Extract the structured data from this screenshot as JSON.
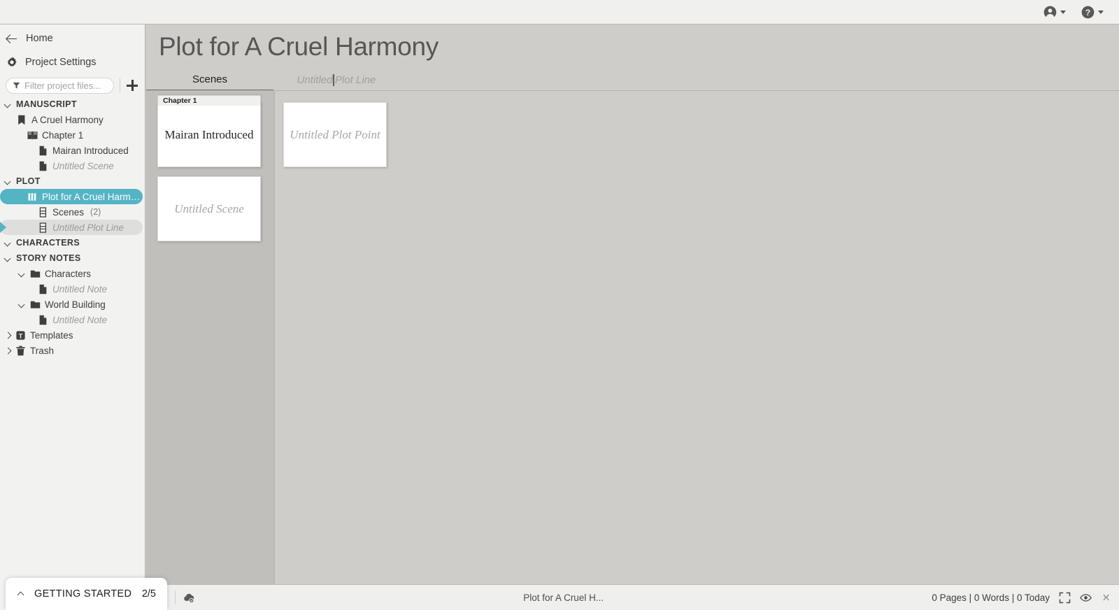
{
  "topbar": {
    "account_icon": "account-circle-icon",
    "account_caret": "chevron-down-icon",
    "help_icon": "help-circle-icon",
    "help_caret": "chevron-down-icon"
  },
  "sidebar": {
    "home_label": "Home",
    "home_icon": "arrow-left-icon",
    "project_settings_label": "Project Settings",
    "project_settings_icon": "gear-icon",
    "filter": {
      "placeholder": "Filter project files...",
      "value": "",
      "icon": "filter-funnel-icon"
    },
    "add_icon": "plus-icon",
    "groups": [
      {
        "name": "MANUSCRIPT",
        "expanded": true,
        "items": [
          {
            "label": "A Cruel Harmony",
            "icon": "book-closed-icon",
            "indent": 1,
            "italic": false,
            "state": "none"
          },
          {
            "label": "Chapter 1",
            "icon": "book-open-icon",
            "indent": 2,
            "italic": false,
            "state": "none"
          },
          {
            "label": "Mairan Introduced",
            "icon": "document-icon",
            "indent": 3,
            "italic": false,
            "state": "none"
          },
          {
            "label": "Untitled Scene",
            "icon": "document-icon",
            "indent": 3,
            "italic": true,
            "state": "none"
          }
        ]
      },
      {
        "name": "PLOT",
        "expanded": true,
        "items": [
          {
            "label": "Plot for A Cruel Harmony",
            "icon": "plot-bars-icon",
            "indent": 2,
            "italic": false,
            "state": "selected"
          },
          {
            "label": "Scenes",
            "count": "(2)",
            "icon": "plotline-icon",
            "indent": 3,
            "italic": false,
            "state": "none"
          },
          {
            "label": "Untitled Plot Line",
            "icon": "plotline-icon",
            "indent": 3,
            "italic": true,
            "state": "active"
          }
        ]
      },
      {
        "name": "CHARACTERS",
        "expanded": true,
        "items": []
      },
      {
        "name": "STORY NOTES",
        "expanded": true,
        "items": [
          {
            "label": "Characters",
            "icon": "folder-icon",
            "indent": 2,
            "italic": false,
            "state": "none",
            "chevron": "down"
          },
          {
            "label": "Untitled Note",
            "icon": "document-icon",
            "indent": 3,
            "italic": true,
            "state": "none"
          },
          {
            "label": "World Building",
            "icon": "folder-icon",
            "indent": 2,
            "italic": false,
            "state": "none",
            "chevron": "down"
          },
          {
            "label": "Untitled Note",
            "icon": "document-icon",
            "indent": 3,
            "italic": true,
            "state": "none"
          }
        ]
      }
    ],
    "footer_items": [
      {
        "label": "Templates",
        "icon": "templates-t-icon",
        "chevron": "right"
      },
      {
        "label": "Trash",
        "icon": "trash-icon",
        "chevron": "right"
      }
    ]
  },
  "getting_started": {
    "label": "GETTING STARTED",
    "progress": "2/5",
    "collapse_icon": "chevron-up-icon"
  },
  "main": {
    "title": "Plot for A Cruel Harmony",
    "tabs": [
      {
        "label": "Scenes",
        "active": true
      },
      {
        "label_before_caret": "Untitled ",
        "label_after_caret": "Plot Line",
        "active": false,
        "editing": true
      }
    ],
    "board": {
      "scenes_column": {
        "chapter_tag": "Chapter 1",
        "cards": [
          {
            "text": "Mairan Introduced",
            "placeholder": false
          },
          {
            "text": "Untitled Scene",
            "placeholder": true
          }
        ]
      },
      "plot_column": {
        "cards": [
          {
            "text": "Untitled Plot Point",
            "placeholder": true
          }
        ]
      }
    }
  },
  "statusbar": {
    "save_icon": "save-disk-check-icon",
    "cloud_icon": "cloud-sync-check-icon",
    "center_text": "Plot for A Cruel H...",
    "stats": "0 Pages | 0 Words | 0 Today",
    "fullscreen_icon": "fullscreen-icon",
    "eye_icon": "eye-icon",
    "collapse_icon": "collapse-panel-icon"
  },
  "colors": {
    "accent_teal": "#54b4c4",
    "sidebar_bg": "#f2f2f1",
    "board_bg": "#cecdc9",
    "scene_column_bg": "#c0bfbc",
    "topbar_bg": "#f0f0ef"
  }
}
